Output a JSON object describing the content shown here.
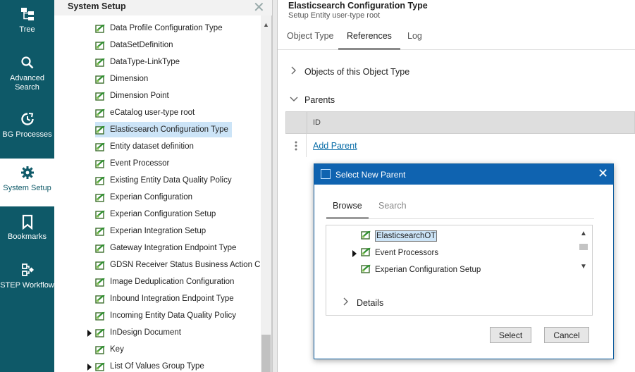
{
  "nav": {
    "items": [
      {
        "label": "Tree",
        "icon": "tree-icon"
      },
      {
        "label": "Advanced\nSearch",
        "icon": "search-icon"
      },
      {
        "label": "BG Processes",
        "icon": "background-process-icon"
      },
      {
        "label": "System Setup",
        "icon": "gear-icon"
      },
      {
        "label": "Bookmarks",
        "icon": "bookmark-icon"
      },
      {
        "label": "STEP Workflow",
        "icon": "workflow-icon"
      }
    ]
  },
  "tree": {
    "title": "System Setup",
    "items": [
      {
        "label": "Data Profile Configuration Type",
        "expandable": false
      },
      {
        "label": "DataSetDefinition",
        "expandable": false
      },
      {
        "label": "DataType-LinkType",
        "expandable": false
      },
      {
        "label": "Dimension",
        "expandable": false
      },
      {
        "label": "Dimension Point",
        "expandable": false
      },
      {
        "label": "eCatalog user-type root",
        "expandable": false
      },
      {
        "label": "Elasticsearch Configuration Type",
        "expandable": false,
        "selected": true
      },
      {
        "label": "Entity dataset definition",
        "expandable": false
      },
      {
        "label": "Event Processor",
        "expandable": false
      },
      {
        "label": "Existing Entity Data Quality Policy",
        "expandable": false
      },
      {
        "label": "Experian Configuration",
        "expandable": false
      },
      {
        "label": "Experian Configuration Setup",
        "expandable": false
      },
      {
        "label": "Experian Integration Setup",
        "expandable": false
      },
      {
        "label": "Gateway Integration Endpoint Type",
        "expandable": false
      },
      {
        "label": "GDSN Receiver Status Business Action Co",
        "expandable": false
      },
      {
        "label": "Image Deduplication Configuration",
        "expandable": false
      },
      {
        "label": "Inbound Integration Endpoint Type",
        "expandable": false
      },
      {
        "label": "Incoming Entity Data Quality Policy",
        "expandable": false
      },
      {
        "label": "InDesign Document",
        "expandable": true
      },
      {
        "label": "Key",
        "expandable": false
      },
      {
        "label": "List Of Values Group Type",
        "expandable": true
      }
    ]
  },
  "detail": {
    "title": "Elasticsearch Configuration Type",
    "subtitle": "Setup Entity user-type root",
    "tabs": [
      "Object Type",
      "References",
      "Log"
    ],
    "active_tab": "References",
    "sections": {
      "objects": "Objects of this Object Type",
      "parents": "Parents"
    },
    "grid": {
      "column": "ID",
      "add_link": "Add Parent"
    }
  },
  "dialog": {
    "title": "Select New Parent",
    "tabs": [
      "Browse",
      "Search"
    ],
    "active_tab": "Browse",
    "items": [
      {
        "label": "ElasticsearchOT",
        "selected": true,
        "expandable": false
      },
      {
        "label": "Event Processors",
        "selected": false,
        "expandable": true
      },
      {
        "label": "Experian Configuration Setup",
        "selected": false,
        "expandable": false
      }
    ],
    "details_label": "Details",
    "select_button": "Select",
    "cancel_button": "Cancel"
  },
  "colors": {
    "nav_background": "#0e5968",
    "dialog_titlebar": "#0f63b0",
    "selection": "#cce4f7",
    "link": "#0b6ea8"
  }
}
